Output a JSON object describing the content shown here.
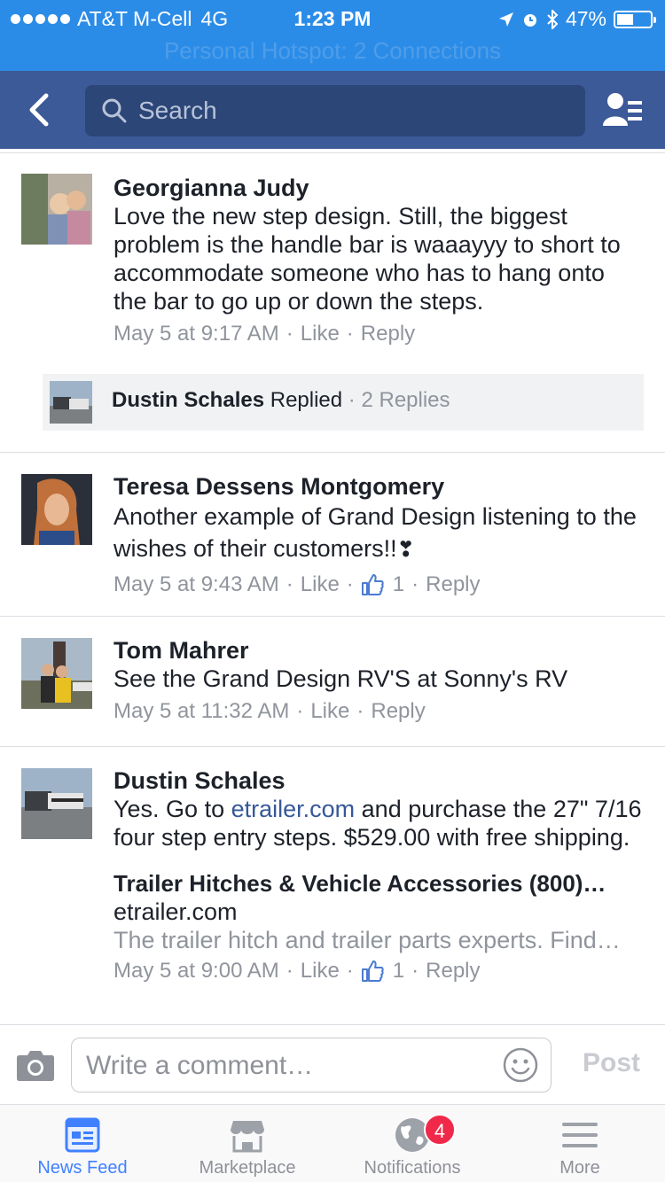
{
  "status_bar": {
    "carrier": "AT&T M-Cell",
    "network": "4G",
    "time": "1:23 PM",
    "battery": "47%",
    "battery_level": 0.47,
    "ghost_title": "Personal Hotspot: 2 Connections"
  },
  "nav": {
    "search_placeholder": "Search"
  },
  "comments": [
    {
      "name": "Georgianna Judy",
      "text": "Love the new step design.  Still, the biggest problem is the handle bar is waaayyy to short to accommodate someone who has to hang onto the bar to go up or down the steps.",
      "time": "May 5 at 9:17 AM",
      "like": "Like",
      "reply": "Reply"
    },
    {
      "name": "Teresa Dessens Montgomery",
      "text": "Another example of Grand Design listening to the wishes of their customers!!",
      "emoji": "❣",
      "time": "May 5 at 9:43 AM",
      "like": "Like",
      "like_count": "1",
      "reply": "Reply"
    },
    {
      "name": "Tom Mahrer",
      "text": "See the Grand Design RV'S at Sonny's RV",
      "time": "May 5 at 11:32 AM",
      "like": "Like",
      "reply": "Reply"
    },
    {
      "name": "Dustin Schales",
      "text_before": "Yes. Go to ",
      "link": "etrailer.com",
      "text_after": " and purchase the 27\" 7/16 four step entry steps. $529.00 with free shipping.",
      "preview_title": "Trailer Hitches & Vehicle Accessories (800)…",
      "preview_domain": "etrailer.com",
      "preview_desc": "The trailer hitch and trailer parts experts. Find…",
      "time": "May 5 at 9:00 AM",
      "like": "Like",
      "like_count": "1",
      "reply": "Reply"
    }
  ],
  "reply_summary": {
    "name": "Dustin Schales",
    "action": "Replied",
    "count": "2 Replies"
  },
  "composer": {
    "placeholder": "Write a comment…",
    "post_label": "Post"
  },
  "tabs": [
    {
      "label": "News Feed",
      "icon": "news-feed-icon",
      "active": true
    },
    {
      "label": "Marketplace",
      "icon": "marketplace-icon"
    },
    {
      "label": "Notifications",
      "icon": "globe-icon",
      "badge": "4"
    },
    {
      "label": "More",
      "icon": "menu-icon"
    }
  ],
  "colors": {
    "status_bar": "#2b8ce8",
    "nav_bar": "#3c5998",
    "link": "#365899",
    "active_tab": "#4080ff",
    "badge": "#f02849"
  }
}
